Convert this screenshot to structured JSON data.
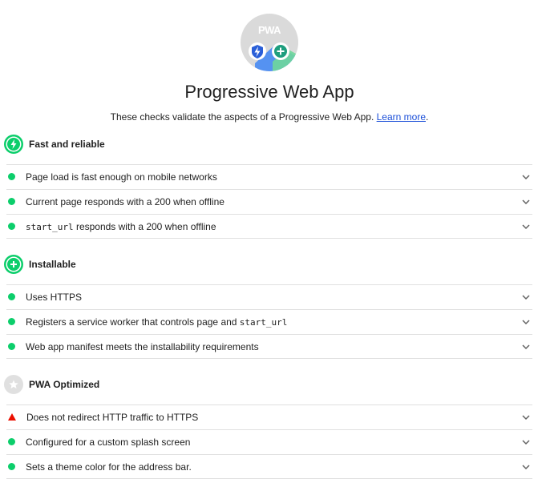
{
  "header": {
    "badge_text": "PWA",
    "title": "Progressive Web App",
    "description_prefix": "These checks validate the aspects of a Progressive Web App. ",
    "learn_more": "Learn more",
    "description_suffix": "."
  },
  "groups": [
    {
      "title": "Fast and reliable",
      "icon": "lightning-icon",
      "audits": [
        {
          "status": "pass",
          "text": "Page load is fast enough on mobile networks"
        },
        {
          "status": "pass",
          "text": "Current page responds with a 200 when offline"
        },
        {
          "status": "pass",
          "code": "start_url",
          "text": " responds with a 200 when offline"
        }
      ]
    },
    {
      "title": "Installable",
      "icon": "plus-icon",
      "audits": [
        {
          "status": "pass",
          "text": "Uses HTTPS"
        },
        {
          "status": "pass",
          "text": "Registers a service worker that controls page and ",
          "code": "start_url"
        },
        {
          "status": "pass",
          "text": "Web app manifest meets the installability requirements"
        }
      ]
    },
    {
      "title": "PWA Optimized",
      "icon": "star-icon",
      "audits": [
        {
          "status": "fail",
          "text": "Does not redirect HTTP traffic to HTTPS"
        },
        {
          "status": "pass",
          "text": "Configured for a custom splash screen"
        },
        {
          "status": "pass",
          "text": "Sets a theme color for the address bar."
        }
      ]
    }
  ],
  "colors": {
    "pass": "#0cce6b",
    "fail": "#eb0f00",
    "link": "#1a4ed8",
    "divider": "#e0e0e0"
  }
}
